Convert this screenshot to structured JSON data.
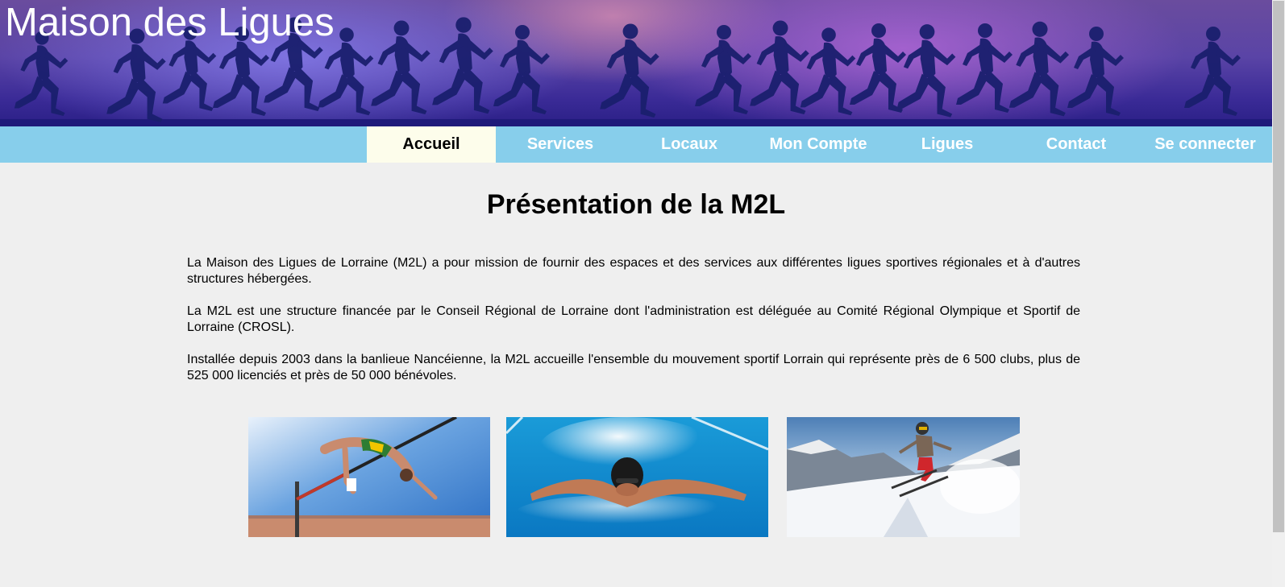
{
  "site": {
    "title": "Maison des Ligues"
  },
  "nav": {
    "items": [
      {
        "label": "Accueil",
        "active": true
      },
      {
        "label": "Services",
        "active": false
      },
      {
        "label": "Locaux",
        "active": false
      },
      {
        "label": "Mon Compte",
        "active": false
      },
      {
        "label": "Ligues",
        "active": false
      },
      {
        "label": "Contact",
        "active": false
      },
      {
        "label": "Se connecter",
        "active": false
      }
    ]
  },
  "main": {
    "heading": "Présentation de la M2L",
    "paragraphs": [
      "La Maison des Ligues de Lorraine (M2L) a pour mission de fournir des espaces et des services aux différentes ligues sportives régionales et à d'autres structures hébergées.",
      "La M2L est une structure financée par le Conseil Régional de Lorraine dont l'administration est déléguée au Comité Régional Olympique et Sportif de Lorraine (CROSL).",
      "Installée depuis 2003 dans la banlieue Nancéienne, la M2L accueille l'ensemble du mouvement sportif Lorrain qui représente près de 6 500 clubs, plus de 525 000 licenciés et près de 50 000 bénévoles."
    ],
    "photos": [
      {
        "subject": "high-jump-photo"
      },
      {
        "subject": "swimming-photo"
      },
      {
        "subject": "skiing-photo"
      }
    ]
  },
  "colors": {
    "nav_background": "#87ceeb",
    "nav_active_background": "#fdfdeb",
    "page_background": "#efefef",
    "banner_accent": "#3b2b97"
  }
}
